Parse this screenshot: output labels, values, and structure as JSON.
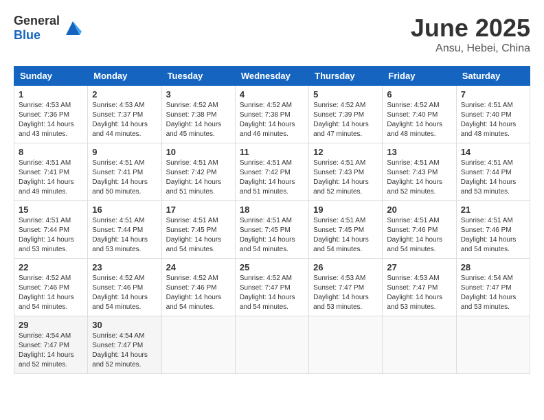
{
  "header": {
    "logo_general": "General",
    "logo_blue": "Blue",
    "month": "June 2025",
    "location": "Ansu, Hebei, China"
  },
  "weekdays": [
    "Sunday",
    "Monday",
    "Tuesday",
    "Wednesday",
    "Thursday",
    "Friday",
    "Saturday"
  ],
  "weeks": [
    [
      {
        "day": "1",
        "sunrise": "4:53 AM",
        "sunset": "7:36 PM",
        "daylight": "14 hours and 43 minutes."
      },
      {
        "day": "2",
        "sunrise": "4:53 AM",
        "sunset": "7:37 PM",
        "daylight": "14 hours and 44 minutes."
      },
      {
        "day": "3",
        "sunrise": "4:52 AM",
        "sunset": "7:38 PM",
        "daylight": "14 hours and 45 minutes."
      },
      {
        "day": "4",
        "sunrise": "4:52 AM",
        "sunset": "7:38 PM",
        "daylight": "14 hours and 46 minutes."
      },
      {
        "day": "5",
        "sunrise": "4:52 AM",
        "sunset": "7:39 PM",
        "daylight": "14 hours and 47 minutes."
      },
      {
        "day": "6",
        "sunrise": "4:52 AM",
        "sunset": "7:40 PM",
        "daylight": "14 hours and 48 minutes."
      },
      {
        "day": "7",
        "sunrise": "4:51 AM",
        "sunset": "7:40 PM",
        "daylight": "14 hours and 48 minutes."
      }
    ],
    [
      {
        "day": "8",
        "sunrise": "4:51 AM",
        "sunset": "7:41 PM",
        "daylight": "14 hours and 49 minutes."
      },
      {
        "day": "9",
        "sunrise": "4:51 AM",
        "sunset": "7:41 PM",
        "daylight": "14 hours and 50 minutes."
      },
      {
        "day": "10",
        "sunrise": "4:51 AM",
        "sunset": "7:42 PM",
        "daylight": "14 hours and 51 minutes."
      },
      {
        "day": "11",
        "sunrise": "4:51 AM",
        "sunset": "7:42 PM",
        "daylight": "14 hours and 51 minutes."
      },
      {
        "day": "12",
        "sunrise": "4:51 AM",
        "sunset": "7:43 PM",
        "daylight": "14 hours and 52 minutes."
      },
      {
        "day": "13",
        "sunrise": "4:51 AM",
        "sunset": "7:43 PM",
        "daylight": "14 hours and 52 minutes."
      },
      {
        "day": "14",
        "sunrise": "4:51 AM",
        "sunset": "7:44 PM",
        "daylight": "14 hours and 53 minutes."
      }
    ],
    [
      {
        "day": "15",
        "sunrise": "4:51 AM",
        "sunset": "7:44 PM",
        "daylight": "14 hours and 53 minutes."
      },
      {
        "day": "16",
        "sunrise": "4:51 AM",
        "sunset": "7:44 PM",
        "daylight": "14 hours and 53 minutes."
      },
      {
        "day": "17",
        "sunrise": "4:51 AM",
        "sunset": "7:45 PM",
        "daylight": "14 hours and 54 minutes."
      },
      {
        "day": "18",
        "sunrise": "4:51 AM",
        "sunset": "7:45 PM",
        "daylight": "14 hours and 54 minutes."
      },
      {
        "day": "19",
        "sunrise": "4:51 AM",
        "sunset": "7:45 PM",
        "daylight": "14 hours and 54 minutes."
      },
      {
        "day": "20",
        "sunrise": "4:51 AM",
        "sunset": "7:46 PM",
        "daylight": "14 hours and 54 minutes."
      },
      {
        "day": "21",
        "sunrise": "4:51 AM",
        "sunset": "7:46 PM",
        "daylight": "14 hours and 54 minutes."
      }
    ],
    [
      {
        "day": "22",
        "sunrise": "4:52 AM",
        "sunset": "7:46 PM",
        "daylight": "14 hours and 54 minutes."
      },
      {
        "day": "23",
        "sunrise": "4:52 AM",
        "sunset": "7:46 PM",
        "daylight": "14 hours and 54 minutes."
      },
      {
        "day": "24",
        "sunrise": "4:52 AM",
        "sunset": "7:46 PM",
        "daylight": "14 hours and 54 minutes."
      },
      {
        "day": "25",
        "sunrise": "4:52 AM",
        "sunset": "7:47 PM",
        "daylight": "14 hours and 54 minutes."
      },
      {
        "day": "26",
        "sunrise": "4:53 AM",
        "sunset": "7:47 PM",
        "daylight": "14 hours and 53 minutes."
      },
      {
        "day": "27",
        "sunrise": "4:53 AM",
        "sunset": "7:47 PM",
        "daylight": "14 hours and 53 minutes."
      },
      {
        "day": "28",
        "sunrise": "4:54 AM",
        "sunset": "7:47 PM",
        "daylight": "14 hours and 53 minutes."
      }
    ],
    [
      {
        "day": "29",
        "sunrise": "4:54 AM",
        "sunset": "7:47 PM",
        "daylight": "14 hours and 52 minutes."
      },
      {
        "day": "30",
        "sunrise": "4:54 AM",
        "sunset": "7:47 PM",
        "daylight": "14 hours and 52 minutes."
      },
      null,
      null,
      null,
      null,
      null
    ]
  ]
}
